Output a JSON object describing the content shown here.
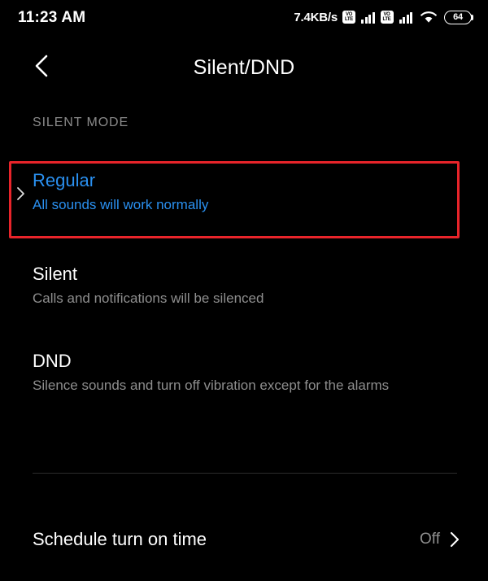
{
  "status_bar": {
    "time": "11:23 AM",
    "network_speed": "7.4KB/s",
    "sim1_label_top": "VO",
    "sim1_label_bottom": "LTE",
    "sim2_label_top": "VO",
    "sim2_label_bottom": "LTE",
    "battery_level": "64"
  },
  "app_bar": {
    "title": "Silent/DND",
    "back_icon": "chevron-left-icon"
  },
  "section": {
    "label": "SILENT MODE"
  },
  "options": [
    {
      "id": "regular",
      "title": "Regular",
      "description": "All sounds will work normally",
      "selected": true,
      "caret_icon": "chevron-right-icon"
    },
    {
      "id": "silent",
      "title": "Silent",
      "description": "Calls and notifications will be silenced",
      "selected": false
    },
    {
      "id": "dnd",
      "title": "DND",
      "description": "Silence sounds and turn off vibration except for the alarms",
      "selected": false
    }
  ],
  "schedule": {
    "label": "Schedule turn on time",
    "value": "Off",
    "chevron_icon": "chevron-right-icon"
  },
  "colors": {
    "background": "#000000",
    "accent_blue": "#2a90f0",
    "highlight_red": "#e8242a",
    "primary_text": "#ffffff",
    "secondary_text": "#8e8e8e",
    "divider": "#2c2c2c"
  }
}
